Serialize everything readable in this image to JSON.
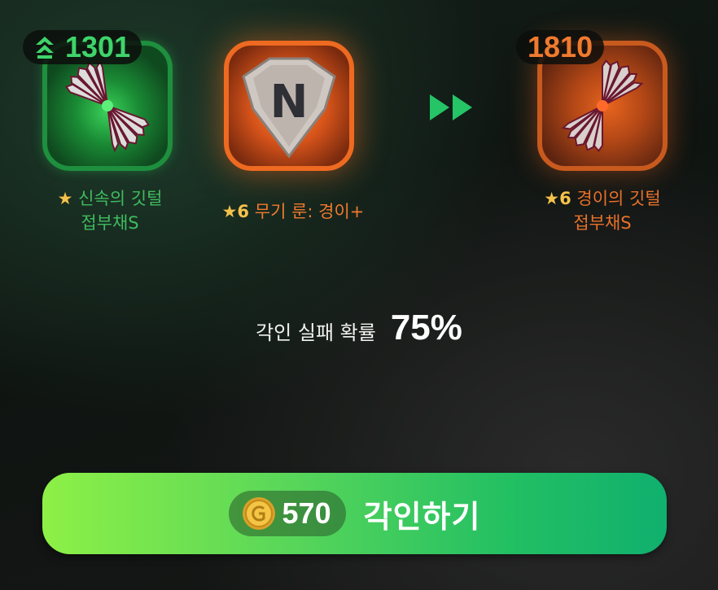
{
  "items": {
    "current": {
      "power": "1301",
      "star": "★",
      "name_line1": "신속의 깃털",
      "name_line2": "접부채S",
      "border_color": "#1e8f3e"
    },
    "rune": {
      "star": "★6",
      "name": "무기 룬: 경이+",
      "rune_letter": "N",
      "border_color": "#ee6a21"
    },
    "result": {
      "power": "1810",
      "star": "★6",
      "name_line1": "경이의 깃털",
      "name_line2": "접부채S",
      "border_color": "#c85a1e"
    }
  },
  "fail_chance": {
    "label": "각인 실패 확률",
    "value": "75%"
  },
  "engrave_button": {
    "cost": "570",
    "label": "각인하기"
  },
  "icons": {
    "power_up": "double-chevron-up-icon",
    "arrow": "fast-forward-icon",
    "coin": "gold-coin-icon"
  }
}
